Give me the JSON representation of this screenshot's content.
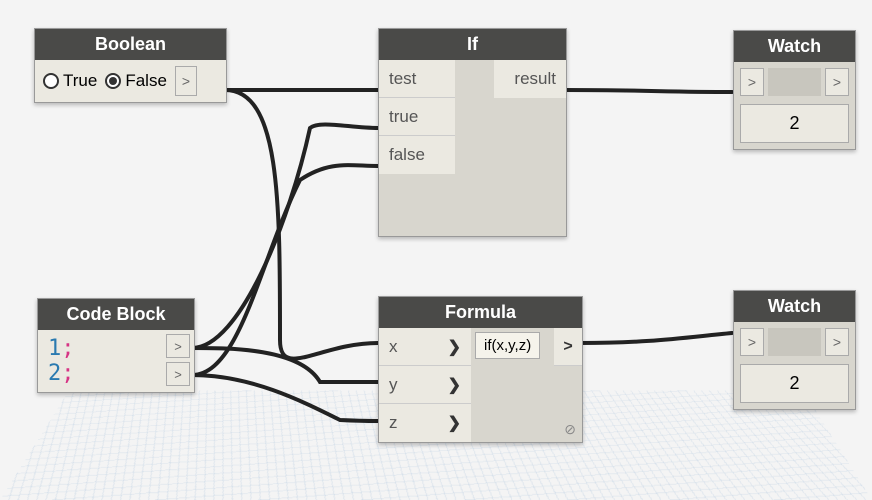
{
  "nodes": {
    "boolean": {
      "title": "Boolean",
      "true_label": "True",
      "false_label": "False",
      "value": false
    },
    "codeblock": {
      "title": "Code Block",
      "line1_num": "1",
      "line1_sym": ";",
      "line2_num": "2",
      "line2_sym": ";"
    },
    "ifnode": {
      "title": "If",
      "in_test": "test",
      "in_true": "true",
      "in_false": "false",
      "out_result": "result"
    },
    "formula": {
      "title": "Formula",
      "in_x": "x",
      "in_y": "y",
      "in_z": "z",
      "expr": "if(x,y,z)"
    },
    "watch1": {
      "title": "Watch",
      "value": "2"
    },
    "watch2": {
      "title": "Watch",
      "value": "2"
    }
  },
  "glyphs": {
    "chevron_right": ">",
    "chevron_bold": "❯"
  }
}
